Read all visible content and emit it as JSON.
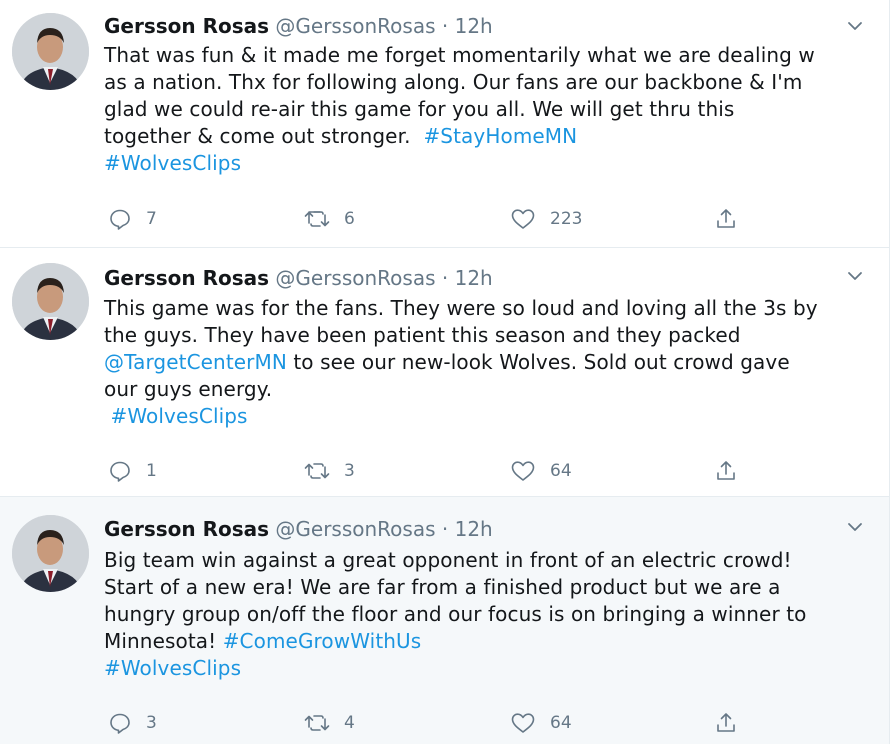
{
  "colors": {
    "link": "#1b95e0",
    "muted": "#657786",
    "text": "#14171a",
    "hover_bg": "#f5f8fa"
  },
  "tweets": [
    {
      "author": "Gersson Rosas",
      "handle": "@GerssonRosas",
      "time": "· 12h",
      "lines": [
        [
          {
            "t": "That was fun & it made me forget momentarily what we are dealing w"
          }
        ],
        [
          {
            "t": "as a nation. Thx for following along. Our fans are our backbone & I'm"
          }
        ],
        [
          {
            "t": "glad we could re-air this game for you all. We will get thru this"
          }
        ],
        [
          {
            "t": "together & come out stronger.  "
          },
          {
            "t": "#StayHomeMN",
            "link": true
          }
        ],
        [
          {
            "t": "#WolvesClips",
            "link": true
          }
        ]
      ],
      "replies": "7",
      "retweets": "6",
      "likes": "223"
    },
    {
      "author": "Gersson Rosas",
      "handle": "@GerssonRosas",
      "time": "· 12h",
      "lines": [
        [
          {
            "t": "This game was for the fans. They were so loud and loving all the 3s by"
          }
        ],
        [
          {
            "t": "the guys. They have been patient this season and they packed"
          }
        ],
        [
          {
            "t": "@TargetCenterMN",
            "link": true
          },
          {
            "t": " to see our new-look Wolves. Sold out crowd gave"
          }
        ],
        [
          {
            "t": "our guys energy."
          }
        ],
        [
          {
            "t": " "
          },
          {
            "t": "#WolvesClips",
            "link": true
          }
        ]
      ],
      "replies": "1",
      "retweets": "3",
      "likes": "64"
    },
    {
      "author": "Gersson Rosas",
      "handle": "@GerssonRosas",
      "time": "· 12h",
      "lines": [
        [
          {
            "t": "Big team win against a great opponent in front of an electric crowd!"
          }
        ],
        [
          {
            "t": "Start of a new era! We are far from a finished product but we are a"
          }
        ],
        [
          {
            "t": "hungry group on/off the floor and our focus is on bringing a winner to"
          }
        ],
        [
          {
            "t": "Minnesota! "
          },
          {
            "t": "#ComeGrowWithUs",
            "link": true
          }
        ],
        [
          {
            "t": "#WolvesClips",
            "link": true
          }
        ]
      ],
      "replies": "3",
      "retweets": "4",
      "likes": "64"
    }
  ]
}
